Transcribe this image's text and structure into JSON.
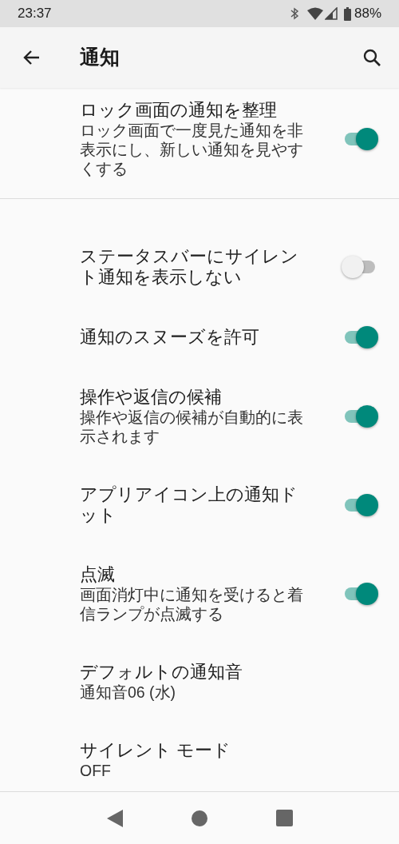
{
  "status_bar": {
    "time": "23:37",
    "battery": "88%"
  },
  "toolbar": {
    "title": "通知"
  },
  "sections": [
    {
      "items": [
        {
          "kind": "switch",
          "title": "ロック画面の通知を整理",
          "summary": "ロック画面で一度見た通知を非表示にし、新しい通知を見やすくする",
          "on": true
        }
      ]
    },
    {
      "items": [
        {
          "kind": "switch",
          "title": "ステータスバーにサイレント通知を表示しない",
          "on": false
        },
        {
          "kind": "switch",
          "title": "通知のスヌーズを許可",
          "on": true
        },
        {
          "kind": "switch",
          "title": "操作や返信の候補",
          "summary": "操作や返信の候補が自動的に表示されます",
          "on": true
        },
        {
          "kind": "switch",
          "title": "アプリアイコン上の通知ドット",
          "on": true
        },
        {
          "kind": "switch",
          "title": "点滅",
          "summary": "画面消灯中に通知を受けると着信ランプが点滅する",
          "on": true
        },
        {
          "kind": "value",
          "title": "デフォルトの通知音",
          "summary": "通知音06 (水)"
        },
        {
          "kind": "value",
          "title": "サイレント モード",
          "summary": "OFF"
        }
      ]
    }
  ]
}
